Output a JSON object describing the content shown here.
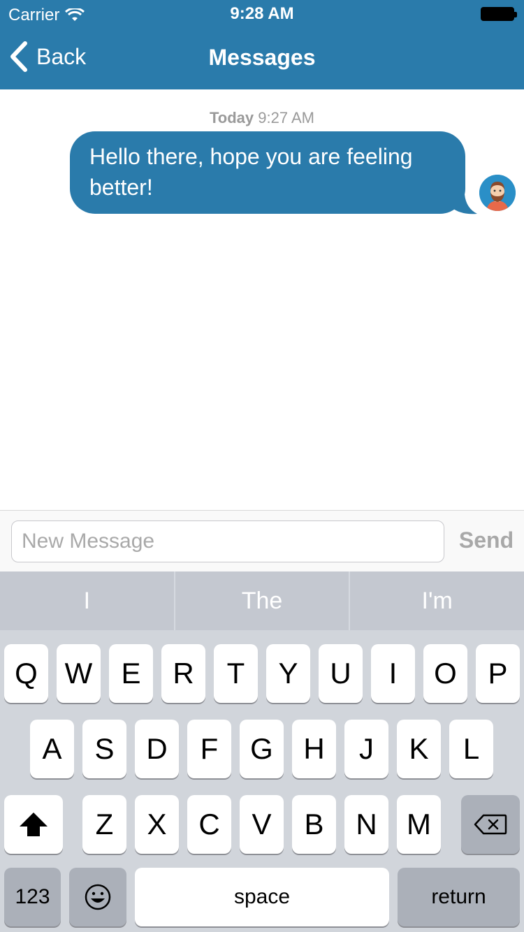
{
  "status_bar": {
    "carrier": "Carrier",
    "time": "9:28 AM"
  },
  "nav": {
    "back_label": "Back",
    "title": "Messages"
  },
  "conversation": {
    "timestamp_day": "Today",
    "timestamp_time": "9:27 AM",
    "messages": [
      {
        "text": "Hello there, hope you are feeling better!"
      }
    ]
  },
  "composer": {
    "placeholder": "New Message",
    "send_label": "Send"
  },
  "predictive": [
    "I",
    "The",
    "I'm"
  ],
  "keyboard": {
    "row1": [
      "Q",
      "W",
      "E",
      "R",
      "T",
      "Y",
      "U",
      "I",
      "O",
      "P"
    ],
    "row2": [
      "A",
      "S",
      "D",
      "F",
      "G",
      "H",
      "J",
      "K",
      "L"
    ],
    "row3": [
      "Z",
      "X",
      "C",
      "V",
      "B",
      "N",
      "M"
    ],
    "numbers_label": "123",
    "space_label": "space",
    "return_label": "return"
  },
  "colors": {
    "brand": "#2a7bab",
    "keyboard_bg": "#d1d5db",
    "predictive_bg": "#c4c8d0"
  }
}
